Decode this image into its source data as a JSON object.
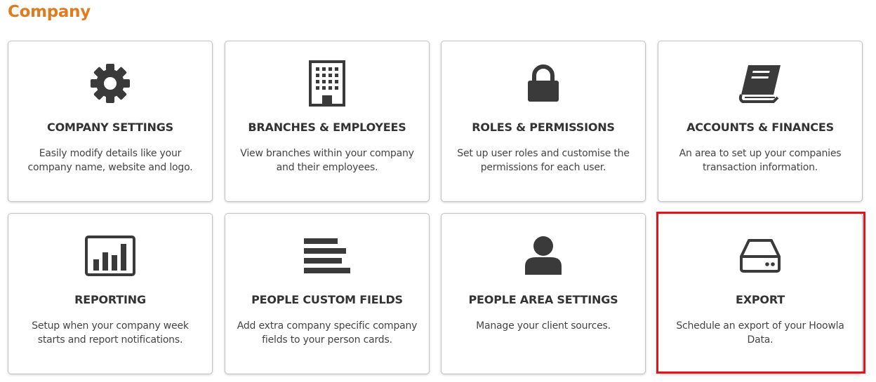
{
  "page": {
    "title": "Company"
  },
  "cards": [
    {
      "icon": "gear-icon",
      "title": "COMPANY SETTINGS",
      "description": "Easily modify details like your company name, website and logo."
    },
    {
      "icon": "building-icon",
      "title": "BRANCHES & EMPLOYEES",
      "description": "View branches within your company and their employees."
    },
    {
      "icon": "lock-icon",
      "title": "ROLES & PERMISSIONS",
      "description": "Set up user roles and customise the permissions for each user."
    },
    {
      "icon": "book-icon",
      "title": "ACCOUNTS & FINANCES",
      "description": "An area to set up your companies transaction information."
    },
    {
      "icon": "bar-chart-icon",
      "title": "REPORTING",
      "description": "Setup when your company week starts and report notifications."
    },
    {
      "icon": "list-icon",
      "title": "PEOPLE CUSTOM FIELDS",
      "description": "Add extra company specific company fields to your person cards."
    },
    {
      "icon": "user-icon",
      "title": "PEOPLE AREA SETTINGS",
      "description": "Manage your client sources."
    },
    {
      "icon": "hard-drive-icon",
      "title": "EXPORT",
      "description": "Schedule an export of your Hoowla Data."
    }
  ],
  "colors": {
    "title": "#e07b1f",
    "icon": "#3a3a3a",
    "highlight": "#e0151b"
  }
}
